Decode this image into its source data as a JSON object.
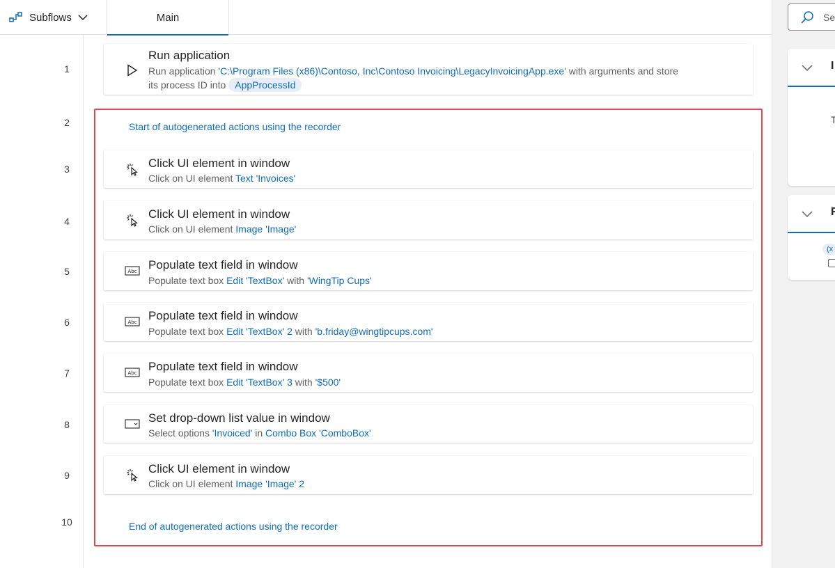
{
  "header": {
    "subflows_label": "Subflows",
    "tab_main_label": "Main"
  },
  "line_numbers": [
    "1",
    "2",
    "3",
    "4",
    "5",
    "6",
    "7",
    "8",
    "9",
    "10"
  ],
  "actions": {
    "a1": {
      "title": "Run application",
      "desc_prefix": "Run application ",
      "path": "'C:\\Program Files (x86)\\Contoso, Inc\\Contoso Invoicing\\LegacyInvoicingApp.exe'",
      "desc_mid": " with arguments  and store",
      "desc_line2": "its process ID into",
      "variable": "AppProcessId"
    },
    "recorder_start": "Start of autogenerated actions using the recorder",
    "a3": {
      "title": "Click UI element in window",
      "desc": "Click on UI element ",
      "target": "Text 'Invoices'"
    },
    "a4": {
      "title": "Click UI element in window",
      "desc": "Click on UI element ",
      "target": "Image 'Image'"
    },
    "a5": {
      "title": "Populate text field in window",
      "desc": "Populate text box ",
      "target": "Edit 'TextBox'",
      "with": " with ",
      "value": "'WingTip Cups'"
    },
    "a6": {
      "title": "Populate text field in window",
      "desc": "Populate text box ",
      "target": "Edit 'TextBox' 2",
      "with": " with ",
      "value": "'b.friday@wingtipcups.com'"
    },
    "a7": {
      "title": "Populate text field in window",
      "desc": "Populate text box ",
      "target": "Edit 'TextBox' 3",
      "with": " with ",
      "value": "'$500'"
    },
    "a8": {
      "title": "Set drop-down list value in window",
      "desc": "Select options ",
      "option": "'Invoiced'",
      "in": " in ",
      "target": "Combo Box 'ComboBox'"
    },
    "a9": {
      "title": "Click UI element in window",
      "desc": "Click on UI element ",
      "target": "Image 'Image' 2"
    },
    "recorder_end": "End of autogenerated actions using the recorder"
  },
  "right_panel": {
    "search_placeholder": "Sea",
    "card1_title": "I",
    "card1_body": "T",
    "card2_title": "F",
    "card2_chip": "(x"
  },
  "colors": {
    "link": "#0f6cbd",
    "selection_border": "#e0484f",
    "variable_pill_bg": "#e8eef8"
  }
}
